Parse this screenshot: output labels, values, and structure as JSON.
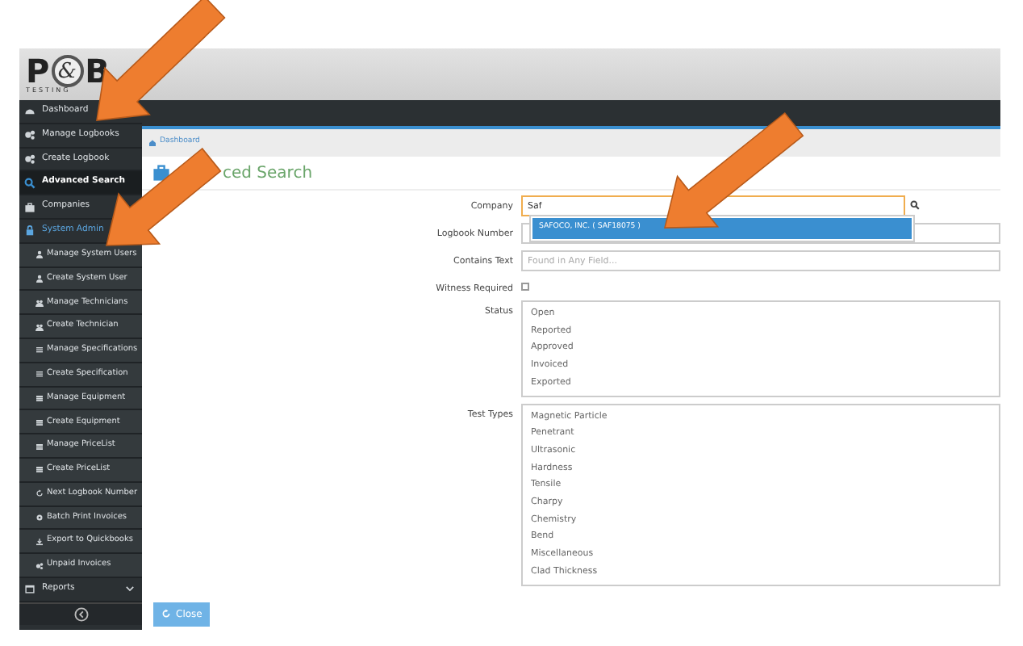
{
  "logo": {
    "initial_left": "P",
    "ampersand": "&",
    "initial_right": "B",
    "tagline": "TESTING"
  },
  "sidebar": {
    "items": [
      {
        "label": "Dashboard",
        "selected": false
      },
      {
        "label": "Manage Logbooks",
        "selected": false
      },
      {
        "label": "Create Logbook",
        "selected": false
      },
      {
        "label": "Advanced Search",
        "selected": true
      },
      {
        "label": "Companies",
        "selected": false
      },
      {
        "label": "System Admin",
        "selected": false,
        "expanded": true,
        "children": [
          {
            "label": "Manage System Users",
            "selected": false
          },
          {
            "label": "Create System User",
            "selected": false
          },
          {
            "label": "Manage Technicians",
            "selected": false
          },
          {
            "label": "Create Technician",
            "selected": false
          },
          {
            "label": "Manage Specifications",
            "selected": false
          },
          {
            "label": "Create Specification",
            "selected": false
          },
          {
            "label": "Manage Equipment",
            "selected": false
          },
          {
            "label": "Create Equipment",
            "selected": false
          },
          {
            "label": "Manage PriceList",
            "selected": false
          },
          {
            "label": "Create PriceList",
            "selected": false
          },
          {
            "label": "Next Logbook Number",
            "selected": false
          },
          {
            "label": "Batch Print Invoices",
            "selected": false
          },
          {
            "label": "Export to Quickbooks",
            "selected": false
          },
          {
            "label": "Unpaid Invoices",
            "selected": false
          }
        ]
      },
      {
        "label": "Reports",
        "selected": false,
        "expanded": false
      }
    ]
  },
  "breadcrumb": [
    "Dashboard"
  ],
  "page_title": "ced Search",
  "form": {
    "company": {
      "label": "Company",
      "value": "Saf",
      "focused": true,
      "suggestions": [
        {
          "label": "SAFOCO, INC. ( SAF18075 )",
          "selected": true
        }
      ]
    },
    "logbook_number": {
      "label": "Logbook Number"
    },
    "contains_text": {
      "label": "Contains Text",
      "placeholder": "Found in Any Field..."
    },
    "witness_required": {
      "label": "Witness Required",
      "checked": false
    },
    "status": {
      "label": "Status",
      "options": [
        "Open",
        "Reported",
        "Approved",
        "Invoiced",
        "Exported"
      ]
    },
    "test_types": {
      "label": "Test Types",
      "options": [
        "Magnetic Particle",
        "Penetrant",
        "Ultrasonic",
        "Hardness",
        "Tensile",
        "Charpy",
        "Chemistry",
        "Bend",
        "Miscellaneous",
        "Clad Thickness"
      ]
    }
  },
  "buttons": [
    {
      "label": "Close"
    }
  ],
  "annotations": [
    {
      "kind": "arrow"
    },
    {
      "kind": "arrow"
    },
    {
      "kind": "arrow"
    }
  ]
}
